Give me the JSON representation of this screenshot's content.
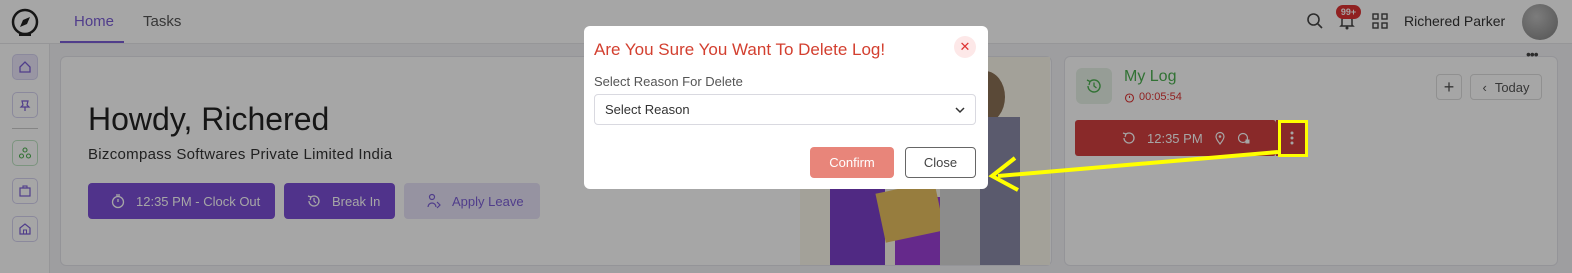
{
  "header": {
    "tabs": [
      {
        "label": "Home",
        "active": true
      },
      {
        "label": "Tasks",
        "active": false
      }
    ],
    "notification_badge": "99+",
    "user_name": "Richered Parker"
  },
  "dashboard": {
    "greeting": "Howdy, Richered",
    "company": "Bizcompass Softwares Private Limited India",
    "actions": {
      "clock_out": "12:35 PM - Clock Out",
      "break_in": "Break In",
      "apply_leave": "Apply Leave"
    }
  },
  "my_log": {
    "title": "My Log",
    "timer": "00:05:54",
    "today_label": "Today",
    "entry_time": "12:35 PM"
  },
  "modal": {
    "title": "Are You Sure You Want To Delete Log!",
    "reason_label": "Select Reason For Delete",
    "select_value": "Select Reason",
    "confirm_label": "Confirm",
    "close_label": "Close"
  },
  "colors": {
    "accent": "#7b4fd6",
    "danger": "#d33f3f",
    "confirm": "#e8857a",
    "annotation": "#ffff00"
  }
}
